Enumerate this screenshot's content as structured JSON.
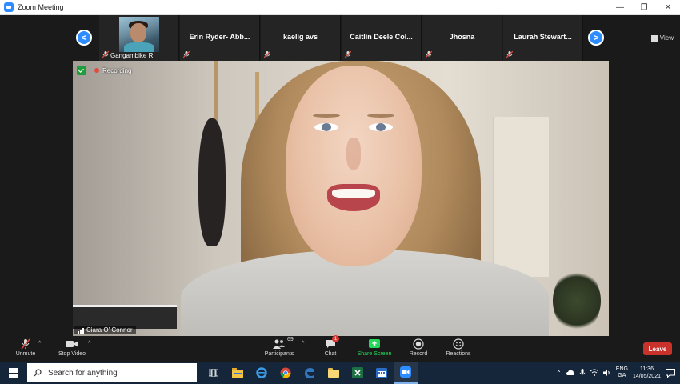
{
  "window": {
    "title": "Zoom Meeting",
    "controls": {
      "minimize": "—",
      "maximize": "❐",
      "close": "✕"
    }
  },
  "gallery": {
    "prev_label": "<",
    "next_label": ">",
    "tiles": [
      {
        "name": "Gangambike R",
        "has_video": true
      },
      {
        "name": "Erin Ryder- Abb..."
      },
      {
        "name": "kaelig avs"
      },
      {
        "name": "Caitlin Deele Col..."
      },
      {
        "name": "Jhosna"
      },
      {
        "name": "Laurah Stewart..."
      }
    ]
  },
  "view": {
    "label": "View"
  },
  "main_video": {
    "recording_label": "Recording",
    "speaker_name": "Ciara O' Connor"
  },
  "toolbar": {
    "unmute": "Unmute",
    "stop_video": "Stop Video",
    "participants": "Participants",
    "participants_count": "69",
    "chat": "Chat",
    "chat_badge": "1",
    "share_screen": "Share Screen",
    "record": "Record",
    "reactions": "Reactions",
    "leave": "Leave",
    "caret": "^"
  },
  "taskbar": {
    "search_placeholder": "Search for anything",
    "lang_line1": "ENG",
    "lang_line2": "GA",
    "time": "11:36",
    "date": "14/05/2021",
    "apps": [
      "task-view",
      "file-explorer",
      "edge-legacy",
      "chrome",
      "edge",
      "folder",
      "excel",
      "outlook-calendar",
      "zoom"
    ]
  },
  "colors": {
    "accent": "#2d8cff",
    "leave": "#c9312b",
    "share_green": "#23d959",
    "taskbar": "#15253a",
    "recording_dot": "#e24b3f"
  }
}
